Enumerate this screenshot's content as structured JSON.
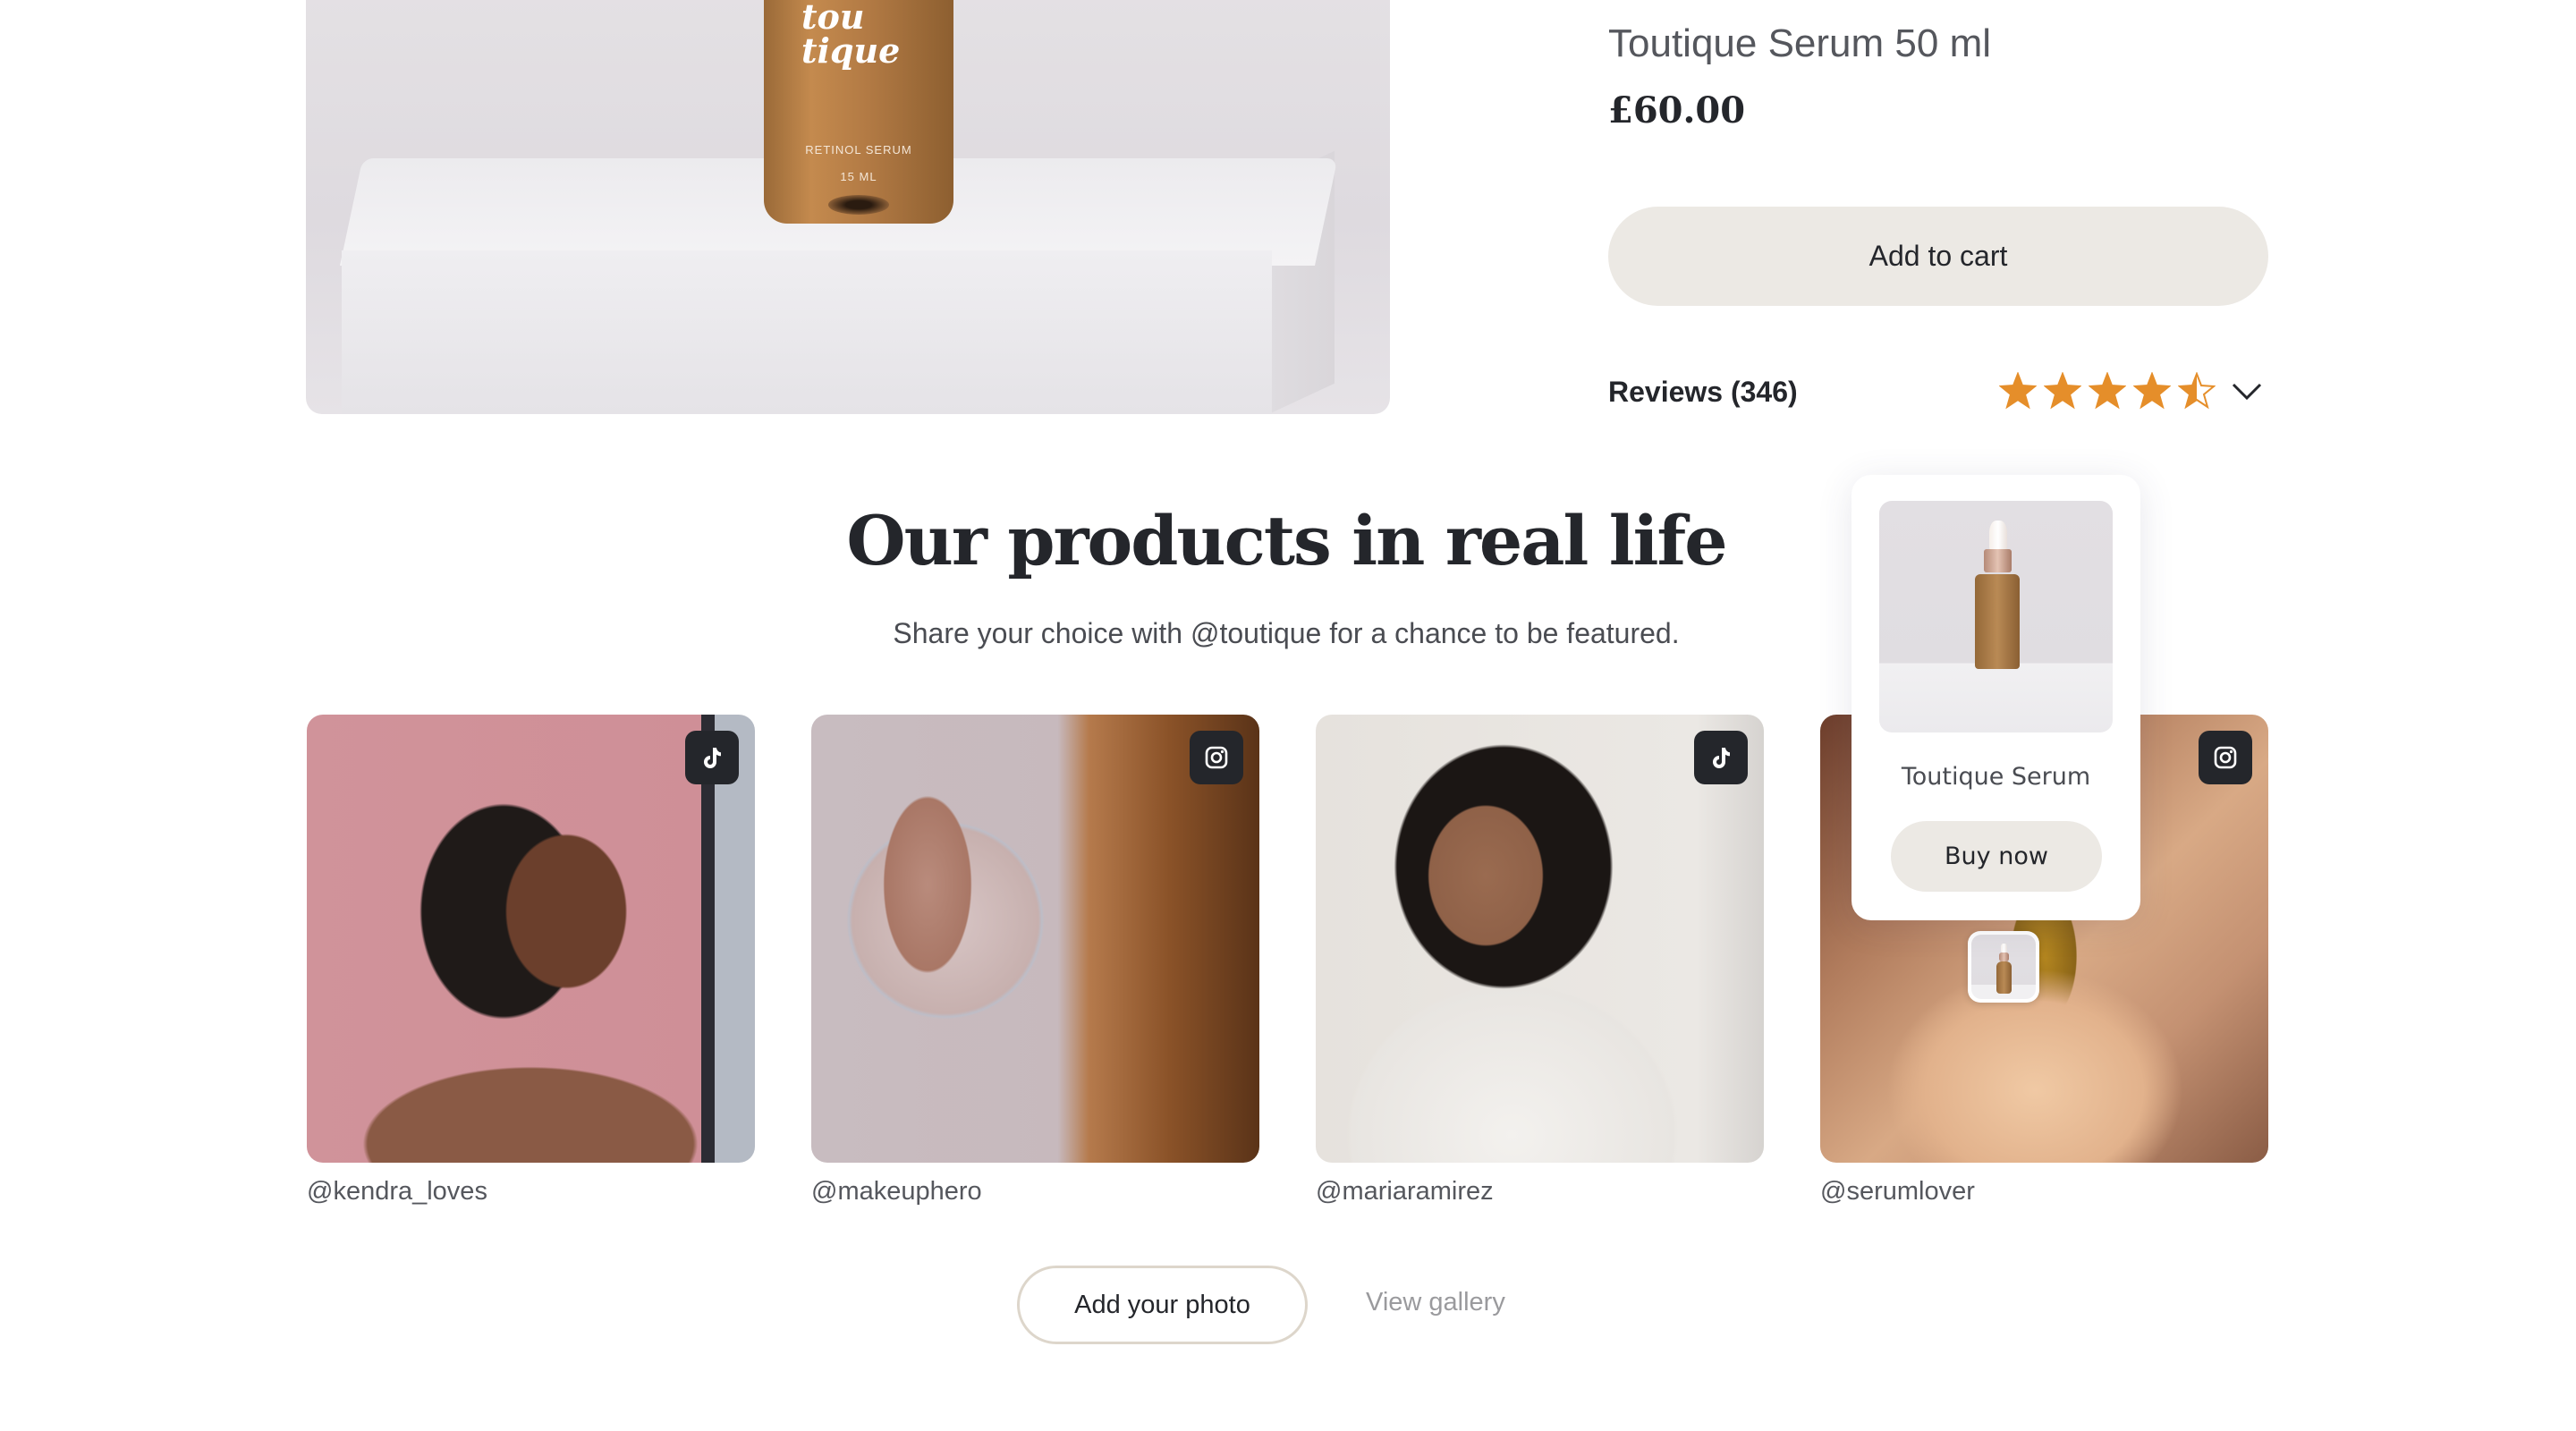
{
  "product": {
    "name": "Toutique Serum 50 ml",
    "price": "£60.00",
    "add_to_cart_label": "Add to cart",
    "hero_image": {
      "alt": "Toutique retinol serum bottle on marble pedestal",
      "bottle_brand_line1": "tou",
      "bottle_brand_line2": "tique",
      "bottle_label": "RETINOL SERUM",
      "bottle_volume": "15 ML"
    },
    "reviews": {
      "label": "Reviews (346)",
      "count": 346,
      "rating": 4.5,
      "max_rating": 5,
      "star_color": "#E58E2A",
      "expand_icon": "chevron-down-icon"
    }
  },
  "ugc": {
    "heading": "Our products in real life",
    "subheading": "Share your choice with @toutique for a chance to be featured.",
    "posts": [
      {
        "handle": "@kendra_loves",
        "platform": "tiktok",
        "icon": "tiktok-icon",
        "alt": "Woman applying cream to cheek in mirror"
      },
      {
        "handle": "@makeuphero",
        "platform": "instagram",
        "icon": "instagram-icon",
        "alt": "Woman applying lipstick using hand mirror"
      },
      {
        "handle": "@mariaramirez",
        "platform": "tiktok",
        "icon": "tiktok-icon",
        "alt": "Woman applying serum with dropper"
      },
      {
        "handle": "@serumlover",
        "platform": "instagram",
        "icon": "instagram-icon",
        "alt": "Serum dropper over skin"
      }
    ],
    "popup": {
      "product_name": "Toutique Serum",
      "buy_label": "Buy now"
    },
    "add_photo_label": "Add your photo",
    "view_gallery_label": "View gallery"
  },
  "colors": {
    "text_primary": "#24262B",
    "text_secondary": "#55575D",
    "button_bg": "#ECE9E4",
    "outline_button_border": "#DDD6CB",
    "badge_bg": "#24262B",
    "link_muted": "#9A9A9D"
  }
}
